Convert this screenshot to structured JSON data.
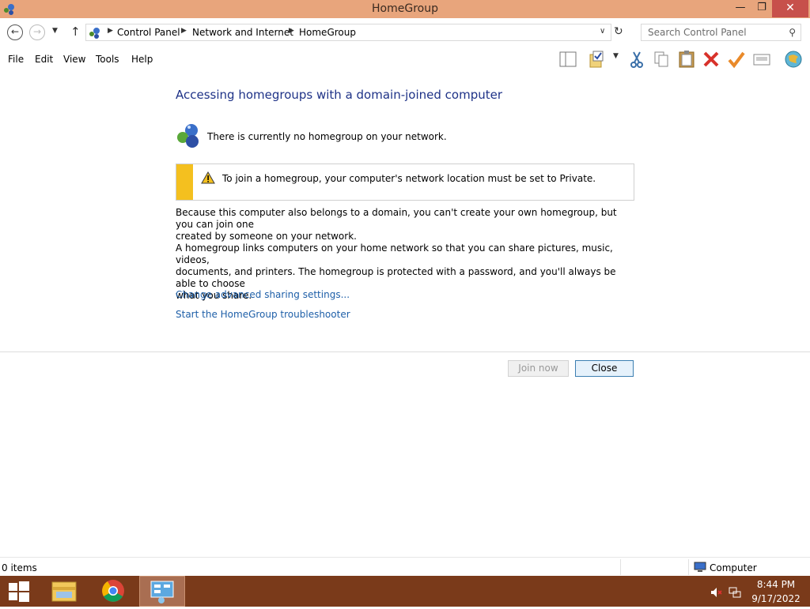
{
  "window": {
    "title": "HomeGroup",
    "minimize_glyph": "—",
    "maximize_glyph": "❐",
    "close_glyph": "✕"
  },
  "navigation": {
    "back_icon": "back-arrow-icon",
    "forward_icon": "forward-arrow-icon",
    "up_icon": "up-arrow-icon",
    "breadcrumb": [
      "Control Panel",
      "Network and Internet",
      "HomeGroup"
    ],
    "search_placeholder": "Search Control Panel"
  },
  "menu": {
    "items": [
      "File",
      "Edit",
      "View",
      "Tools",
      "Help"
    ]
  },
  "toolbar_icons": [
    "preview-pane-icon",
    "folder-check-icon",
    "cut-icon",
    "copy-icon",
    "paste-icon",
    "delete-icon",
    "checkmark-icon",
    "rename-icon",
    "globe-icon"
  ],
  "content": {
    "heading": "Accessing homegroups with a domain-joined computer",
    "status": "There is currently no homegroup on your network.",
    "warning": "To join a homegroup, your computer's network location must be set to Private.",
    "paragraph1_line1": "Because this computer also belongs to a domain, you can't create your own homegroup, but you can join one",
    "paragraph1_line2": "created by someone on your network.",
    "paragraph2_line1": "A homegroup links computers on your home network so that you can share pictures, music, videos,",
    "paragraph2_line2": "documents, and printers. The homegroup is protected with a password, and you'll always be able to choose",
    "paragraph2_line3": "what you share.",
    "link_sharing": "Change advanced sharing settings...",
    "link_troubleshooter": "Start the HomeGroup troubleshooter",
    "join_button": "Join now",
    "close_button": "Close"
  },
  "statusbar": {
    "items": "0 items",
    "location": "Computer"
  },
  "taskbar": {
    "time": "8:44 PM",
    "date": "9/17/2022"
  },
  "colors": {
    "titlebar": "#e8a57c",
    "close_button": "#c7504b",
    "heading": "#1e3287",
    "link": "#1e5fa8",
    "warning_stripe": "#f4c01f",
    "taskbar": "#7a3a1a"
  }
}
